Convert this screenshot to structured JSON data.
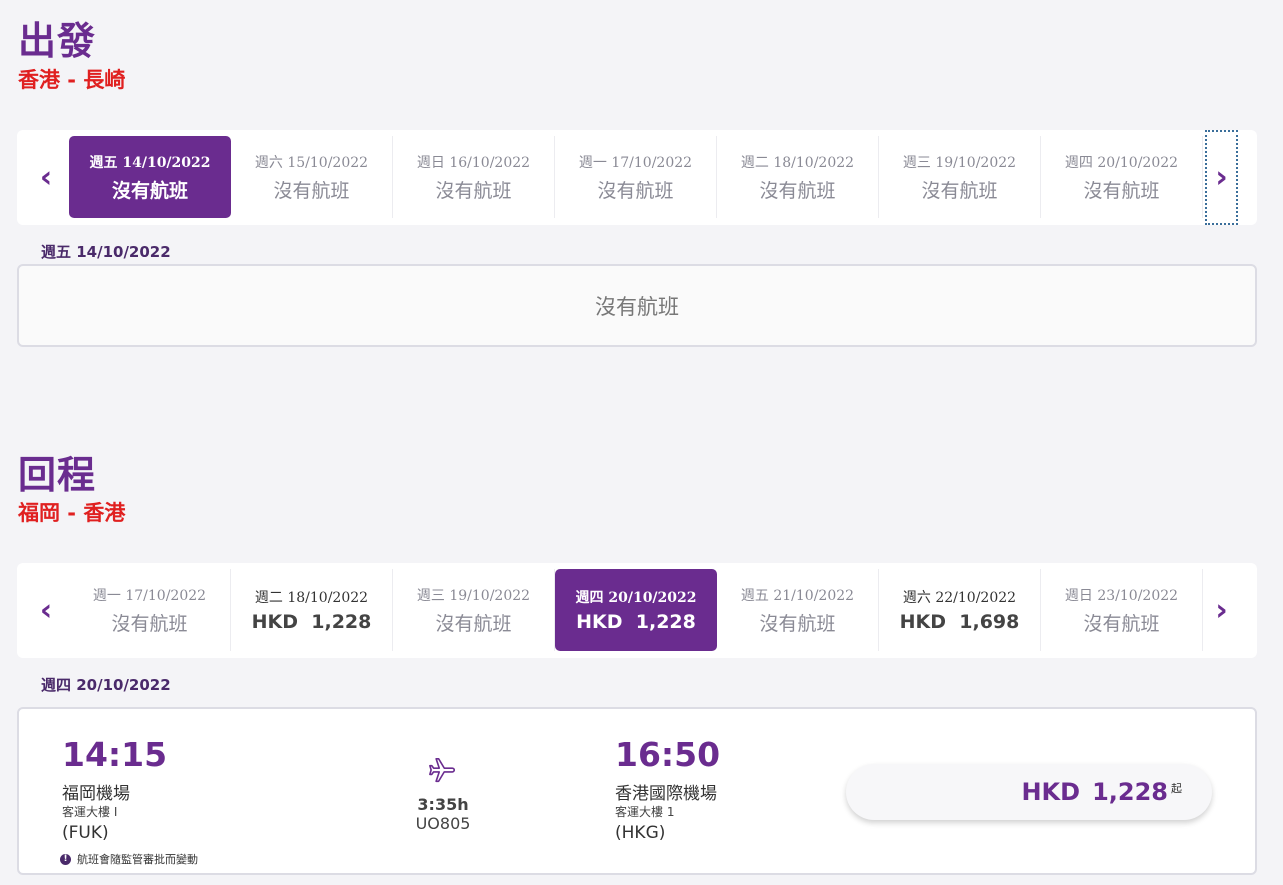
{
  "outbound": {
    "title": "出發",
    "route": "香港 - 長崎",
    "dates": [
      {
        "date": "週五 14/10/2022",
        "value": "沒有航班",
        "active": true,
        "has": false
      },
      {
        "date": "週六 15/10/2022",
        "value": "沒有航班",
        "active": false,
        "has": false
      },
      {
        "date": "週日 16/10/2022",
        "value": "沒有航班",
        "active": false,
        "has": false
      },
      {
        "date": "週一 17/10/2022",
        "value": "沒有航班",
        "active": false,
        "has": false
      },
      {
        "date": "週二 18/10/2022",
        "value": "沒有航班",
        "active": false,
        "has": false
      },
      {
        "date": "週三 19/10/2022",
        "value": "沒有航班",
        "active": false,
        "has": false
      },
      {
        "date": "週四 20/10/2022",
        "value": "沒有航班",
        "active": false,
        "has": false
      }
    ],
    "selected_date": "週五 14/10/2022",
    "no_flight_text": "沒有航班"
  },
  "return": {
    "title": "回程",
    "route": "福岡 - 香港",
    "dates": [
      {
        "date": "週一 17/10/2022",
        "value": "沒有航班",
        "active": false,
        "has": false
      },
      {
        "date": "週二 18/10/2022",
        "value": "HKD  1,228",
        "active": false,
        "has": true
      },
      {
        "date": "週三 19/10/2022",
        "value": "沒有航班",
        "active": false,
        "has": false
      },
      {
        "date": "週四 20/10/2022",
        "value": "HKD  1,228",
        "active": true,
        "has": true
      },
      {
        "date": "週五 21/10/2022",
        "value": "沒有航班",
        "active": false,
        "has": false
      },
      {
        "date": "週六 22/10/2022",
        "value": "HKD  1,698",
        "active": false,
        "has": true
      },
      {
        "date": "週日 23/10/2022",
        "value": "沒有航班",
        "active": false,
        "has": false
      }
    ],
    "selected_date": "週四 20/10/2022",
    "flight": {
      "dep_time": "14:15",
      "dep_airport": "福岡機場",
      "dep_terminal": "客運大樓 I",
      "dep_code": "(FUK)",
      "duration": "3:35h",
      "flight_no": "UO805",
      "arr_time": "16:50",
      "arr_airport": "香港國際機場",
      "arr_terminal": "客運大樓 1",
      "arr_code": "(HKG)",
      "note": "航班會隨監管審批而變動",
      "price_currency": "HKD",
      "price_amount": "1,228",
      "price_suffix": "起"
    }
  },
  "icons": {
    "prev": "chevron-left-icon",
    "next": "chevron-right-icon",
    "plane": "airplane-icon",
    "info": "info-icon"
  },
  "colors": {
    "brand": "#6a2c8f",
    "route": "#e02020"
  }
}
